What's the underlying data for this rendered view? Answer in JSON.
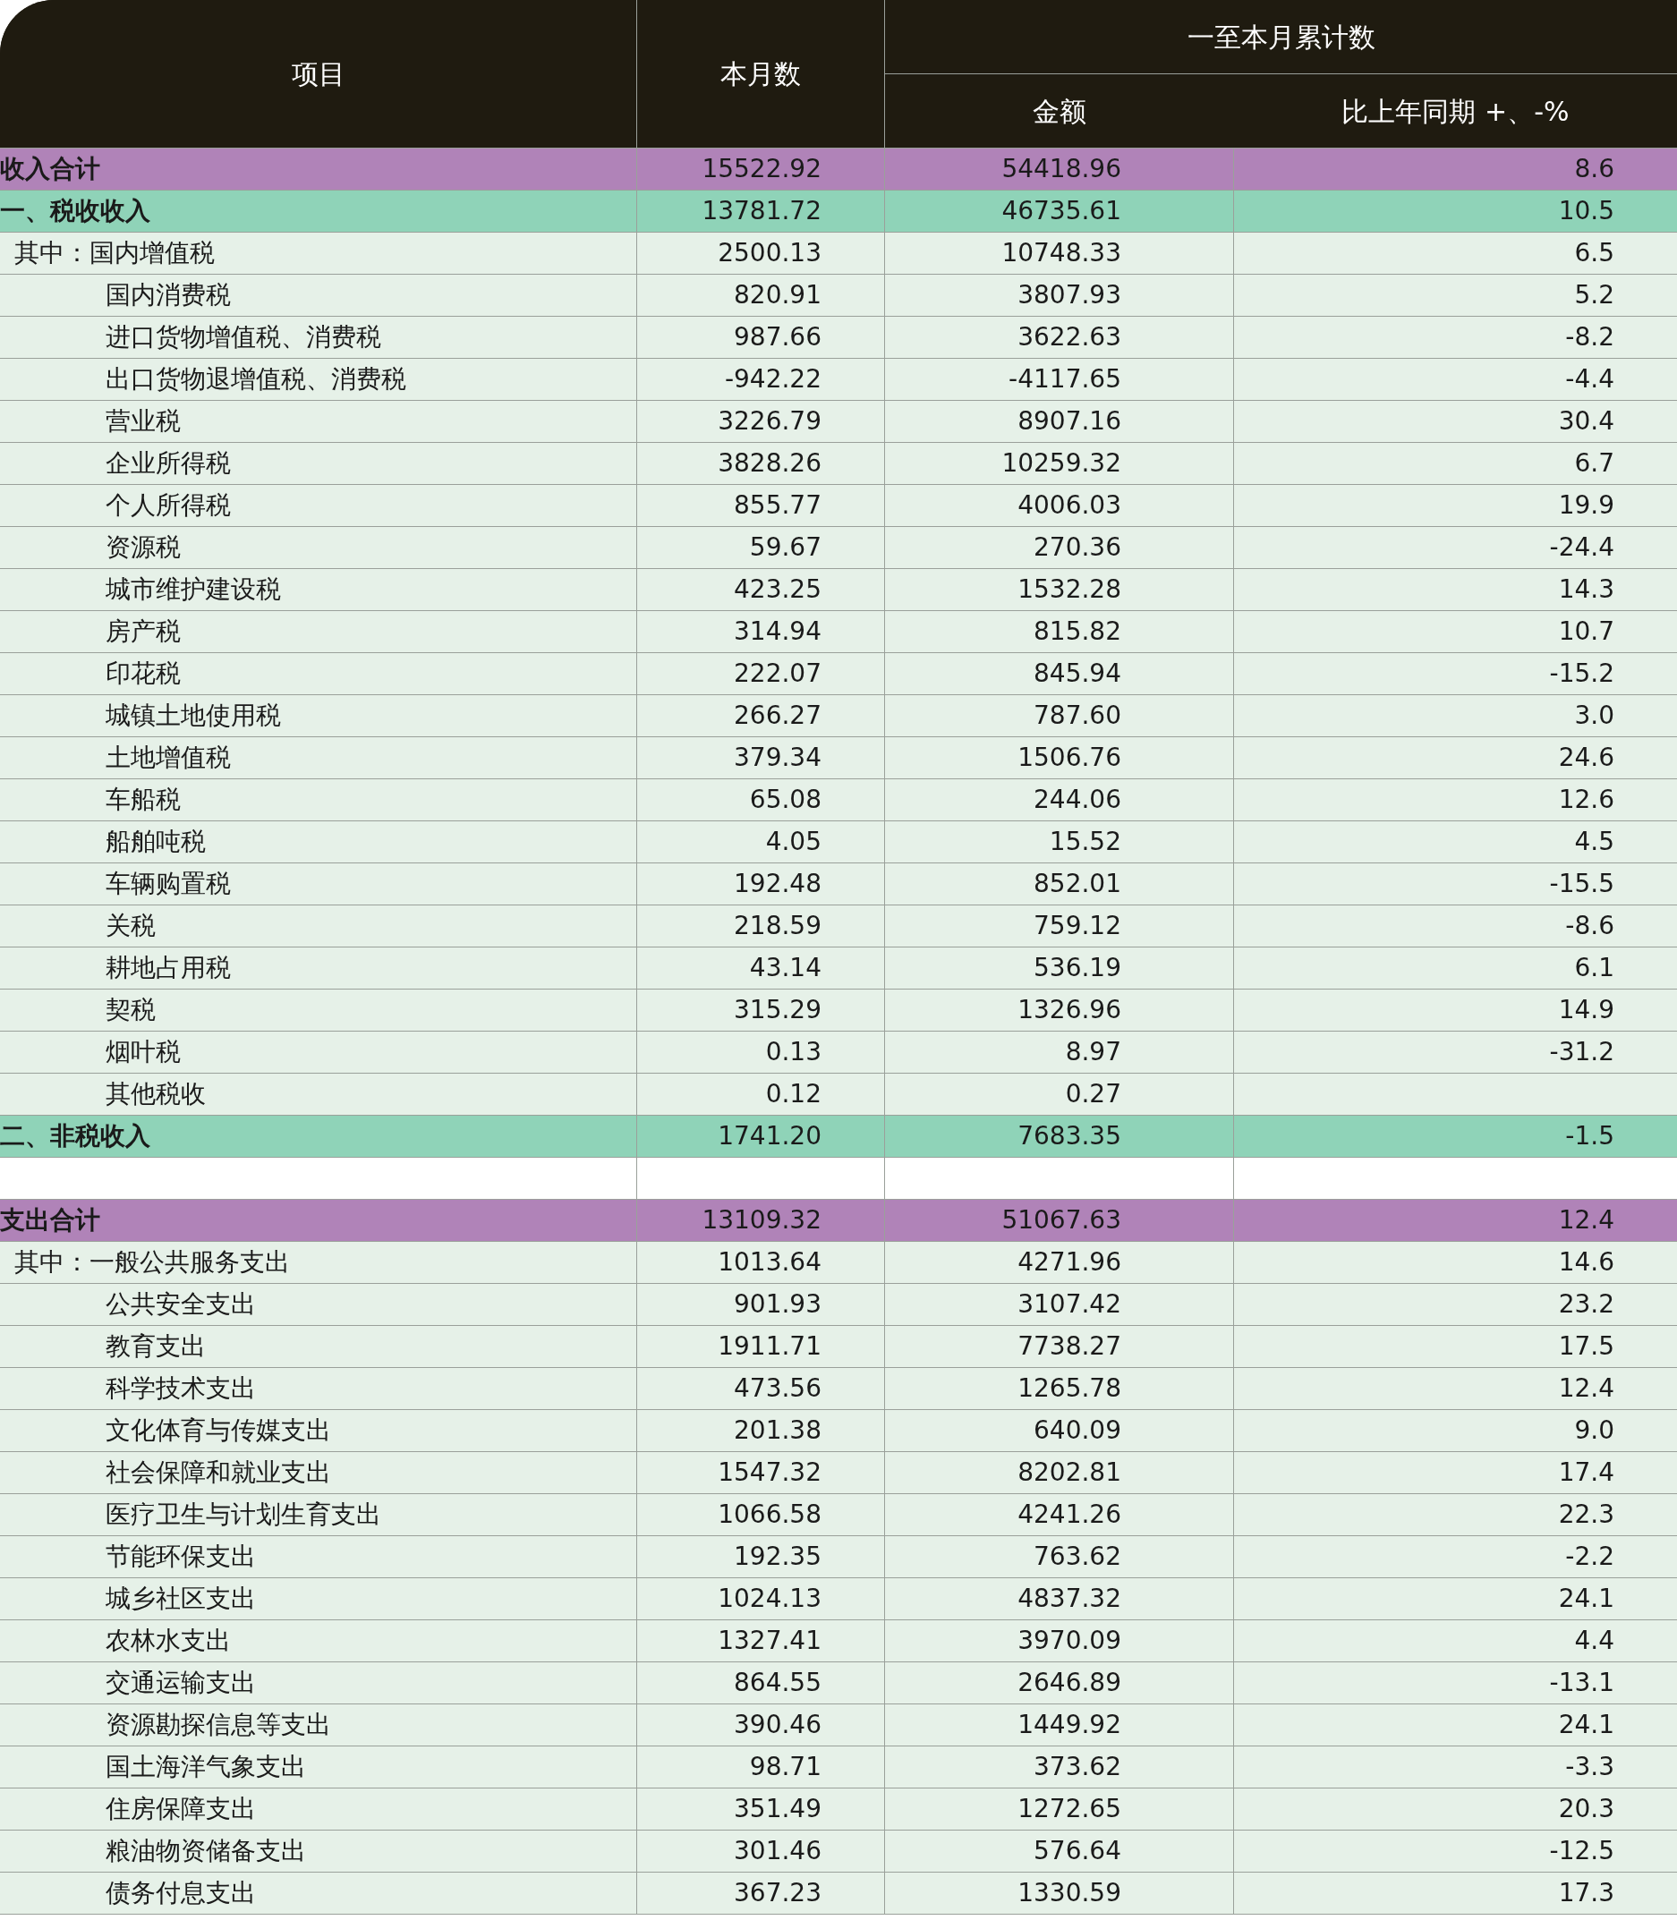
{
  "table": {
    "columns": {
      "item": "项目",
      "month": "本月数",
      "cumulative": "一至本月累计数",
      "amount": "金额",
      "change": "比上年同期 +、-%"
    },
    "rows": [
      {
        "kind": "total",
        "label": "收入合计",
        "month": "15522.92",
        "amount": "54418.96",
        "change": "8.6"
      },
      {
        "kind": "section",
        "label": "一、税收收入",
        "month": "13781.72",
        "amount": "46735.61",
        "change": "10.5"
      },
      {
        "kind": "lead",
        "label": "其中：国内增值税",
        "month": "2500.13",
        "amount": "10748.33",
        "change": "6.5"
      },
      {
        "kind": "item",
        "label": "国内消费税",
        "month": "820.91",
        "amount": "3807.93",
        "change": "5.2"
      },
      {
        "kind": "item",
        "label": "进口货物增值税、消费税",
        "month": "987.66",
        "amount": "3622.63",
        "change": "-8.2"
      },
      {
        "kind": "item",
        "label": "出口货物退增值税、消费税",
        "month": "-942.22",
        "amount": "-4117.65",
        "change": "-4.4"
      },
      {
        "kind": "item",
        "label": "营业税",
        "month": "3226.79",
        "amount": "8907.16",
        "change": "30.4"
      },
      {
        "kind": "item",
        "label": "企业所得税",
        "month": "3828.26",
        "amount": "10259.32",
        "change": "6.7"
      },
      {
        "kind": "item",
        "label": "个人所得税",
        "month": "855.77",
        "amount": "4006.03",
        "change": "19.9"
      },
      {
        "kind": "item",
        "label": "资源税",
        "month": "59.67",
        "amount": "270.36",
        "change": "-24.4"
      },
      {
        "kind": "item",
        "label": "城市维护建设税",
        "month": "423.25",
        "amount": "1532.28",
        "change": "14.3"
      },
      {
        "kind": "item",
        "label": "房产税",
        "month": "314.94",
        "amount": "815.82",
        "change": "10.7"
      },
      {
        "kind": "item",
        "label": "印花税",
        "month": "222.07",
        "amount": "845.94",
        "change": "-15.2"
      },
      {
        "kind": "item",
        "label": "城镇土地使用税",
        "month": "266.27",
        "amount": "787.60",
        "change": "3.0"
      },
      {
        "kind": "item",
        "label": "土地增值税",
        "month": "379.34",
        "amount": "1506.76",
        "change": "24.6"
      },
      {
        "kind": "item",
        "label": "车船税",
        "month": "65.08",
        "amount": "244.06",
        "change": "12.6"
      },
      {
        "kind": "item",
        "label": "船舶吨税",
        "month": "4.05",
        "amount": "15.52",
        "change": "4.5"
      },
      {
        "kind": "item",
        "label": "车辆购置税",
        "month": "192.48",
        "amount": "852.01",
        "change": "-15.5"
      },
      {
        "kind": "item",
        "label": "关税",
        "month": "218.59",
        "amount": "759.12",
        "change": "-8.6"
      },
      {
        "kind": "item",
        "label": "耕地占用税",
        "month": "43.14",
        "amount": "536.19",
        "change": "6.1"
      },
      {
        "kind": "item",
        "label": "契税",
        "month": "315.29",
        "amount": "1326.96",
        "change": "14.9"
      },
      {
        "kind": "item",
        "label": "烟叶税",
        "month": "0.13",
        "amount": "8.97",
        "change": "-31.2"
      },
      {
        "kind": "item",
        "label": "其他税收",
        "month": "0.12",
        "amount": "0.27"
      },
      {
        "kind": "section",
        "label": "二、非税收入",
        "month": "1741.20",
        "amount": "7683.35",
        "change": "-1.5"
      },
      {
        "kind": "blank"
      },
      {
        "kind": "total",
        "label": "支出合计",
        "month": "13109.32",
        "amount": "51067.63",
        "change": "12.4"
      },
      {
        "kind": "lead",
        "label": "其中：一般公共服务支出",
        "month": "1013.64",
        "amount": "4271.96",
        "change": "14.6"
      },
      {
        "kind": "item",
        "label": "公共安全支出",
        "month": "901.93",
        "amount": "3107.42",
        "change": "23.2"
      },
      {
        "kind": "item",
        "label": "教育支出",
        "month": "1911.71",
        "amount": "7738.27",
        "change": "17.5"
      },
      {
        "kind": "item",
        "label": "科学技术支出",
        "month": "473.56",
        "amount": "1265.78",
        "change": "12.4"
      },
      {
        "kind": "item",
        "label": "文化体育与传媒支出",
        "month": "201.38",
        "amount": "640.09",
        "change": "9.0"
      },
      {
        "kind": "item",
        "label": "社会保障和就业支出",
        "month": "1547.32",
        "amount": "8202.81",
        "change": "17.4"
      },
      {
        "kind": "item",
        "label": "医疗卫生与计划生育支出",
        "month": "1066.58",
        "amount": "4241.26",
        "change": "22.3"
      },
      {
        "kind": "item",
        "label": "节能环保支出",
        "month": "192.35",
        "amount": "763.62",
        "change": "-2.2"
      },
      {
        "kind": "item",
        "label": "城乡社区支出",
        "month": "1024.13",
        "amount": "4837.32",
        "change": "24.1"
      },
      {
        "kind": "item",
        "label": "农林水支出",
        "month": "1327.41",
        "amount": "3970.09",
        "change": "4.4"
      },
      {
        "kind": "item",
        "label": "交通运输支出",
        "month": "864.55",
        "amount": "2646.89",
        "change": "-13.1"
      },
      {
        "kind": "item",
        "label": "资源勘探信息等支出",
        "month": "390.46",
        "amount": "1449.92",
        "change": "24.1"
      },
      {
        "kind": "item",
        "label": "国土海洋气象支出",
        "month": "98.71",
        "amount": "373.62",
        "change": "-3.3"
      },
      {
        "kind": "item",
        "label": "住房保障支出",
        "month": "351.49",
        "amount": "1272.65",
        "change": "20.3"
      },
      {
        "kind": "item",
        "label": "粮油物资储备支出",
        "month": "301.46",
        "amount": "576.64",
        "change": "-12.5"
      },
      {
        "kind": "item",
        "label": "债务付息支出",
        "month": "367.23",
        "amount": "1330.59",
        "change": "17.3"
      }
    ]
  }
}
